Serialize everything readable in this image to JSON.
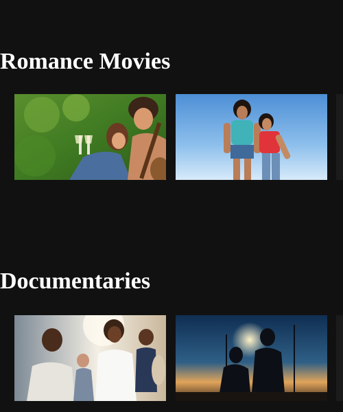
{
  "rows": [
    {
      "title": "Romance Movies",
      "posters": [
        {
          "icon": "couple-with-guitar-image"
        },
        {
          "icon": "two-women-under-sky-image"
        }
      ]
    },
    {
      "title": "Documentaries",
      "posters": [
        {
          "icon": "smiling-crowd-image"
        },
        {
          "icon": "silhouettes-at-sunset-image"
        }
      ]
    }
  ],
  "colors": {
    "background": "#111111",
    "text": "#ffffff"
  }
}
